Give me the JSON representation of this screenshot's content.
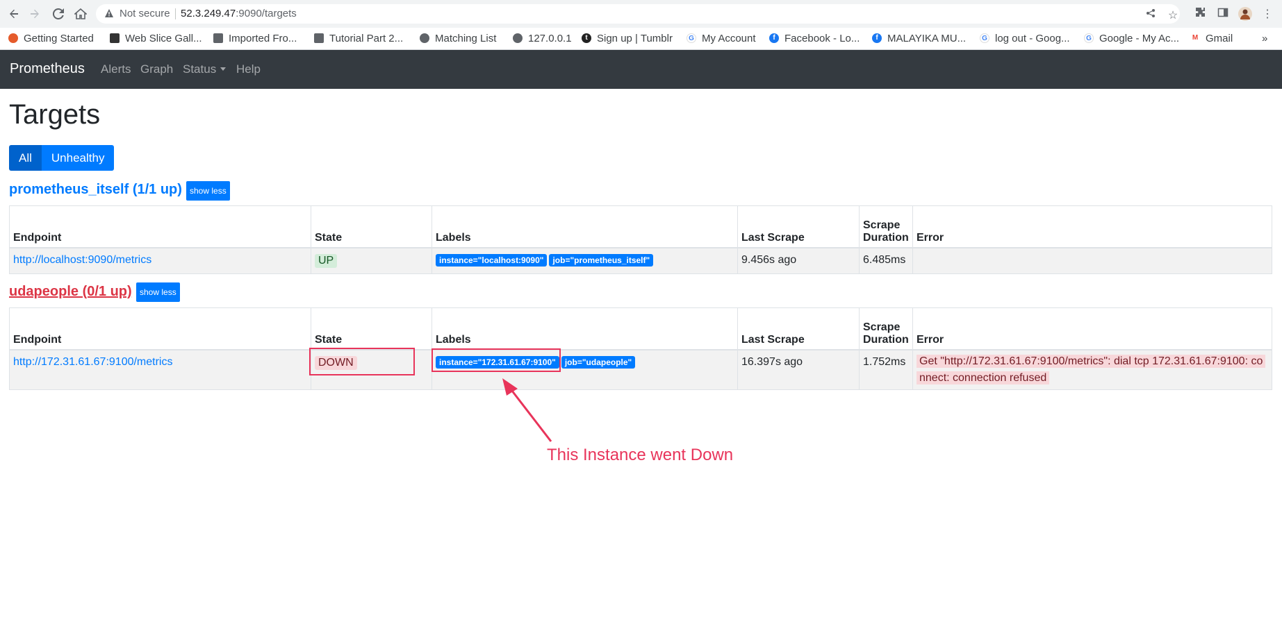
{
  "browser": {
    "not_secure": "Not secure",
    "url_host": "52.3.249.47",
    "url_path": ":9090/targets",
    "bookmarks": [
      "Getting Started",
      "Web Slice Gall...",
      "Imported Fro...",
      "Tutorial Part 2...",
      "Matching List",
      "127.0.0.1",
      "Sign up | Tumblr",
      "My Account",
      "Facebook - Lo...",
      "MALAYIKA MU...",
      "log out - Goog...",
      "Google - My Ac...",
      "Gmail"
    ],
    "more": "»"
  },
  "navbar": {
    "brand": "Prometheus",
    "alerts": "Alerts",
    "graph": "Graph",
    "status": "Status",
    "help": "Help"
  },
  "page": {
    "title": "Targets",
    "filter_all": "All",
    "filter_unhealthy": "Unhealthy"
  },
  "columns": {
    "endpoint": "Endpoint",
    "state": "State",
    "labels": "Labels",
    "last_scrape": "Last Scrape",
    "scrape_duration_1": "Scrape",
    "scrape_duration_2": "Duration",
    "error": "Error"
  },
  "pools": [
    {
      "title": "prometheus_itself (1/1 up)",
      "show_less": "show less",
      "target": {
        "endpoint": "http://localhost:9090/metrics",
        "state": "UP",
        "label_instance": "instance=\"localhost:9090\"",
        "label_job": "job=\"prometheus_itself\"",
        "last_scrape": "9.456s ago",
        "duration": "6.485ms",
        "error": ""
      }
    },
    {
      "title": "udapeople (0/1 up)",
      "show_less": "show less",
      "target": {
        "endpoint": "http://172.31.61.67:9100/metrics",
        "state": "DOWN",
        "label_instance": "instance=\"172.31.61.67:9100\"",
        "label_job": "job=\"udapeople\"",
        "last_scrape": "16.397s ago",
        "duration": "1.752ms",
        "error_line1": "Get \"http://172.31.61.67:9100/metrics\": dial tcp 172.31.61.67:9100: co",
        "error_line2": "nnect: connection refused"
      }
    }
  ],
  "annotation": {
    "text": "This Instance went Down",
    "color": "#e8345a"
  }
}
